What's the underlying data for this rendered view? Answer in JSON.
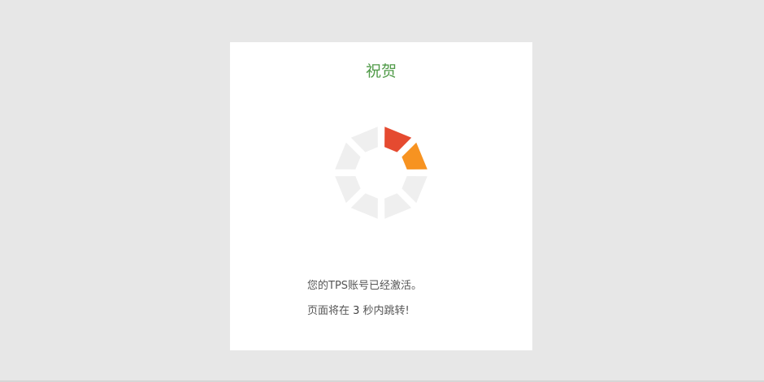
{
  "card": {
    "title": "祝贺",
    "title_color": "#4f9a47"
  },
  "spinner": {
    "icon": "loading-spinner-icon",
    "segments": 8,
    "active_colors": [
      "#e54a30",
      "#f79321"
    ],
    "inactive_color": "#efefef"
  },
  "messages": {
    "activated": "您的TPS账号已经激活。",
    "redirect_prefix": "页面将在 ",
    "countdown": "3",
    "redirect_suffix": " 秒内跳转!"
  },
  "colors": {
    "background": "#e7e7e7",
    "card": "#ffffff"
  }
}
